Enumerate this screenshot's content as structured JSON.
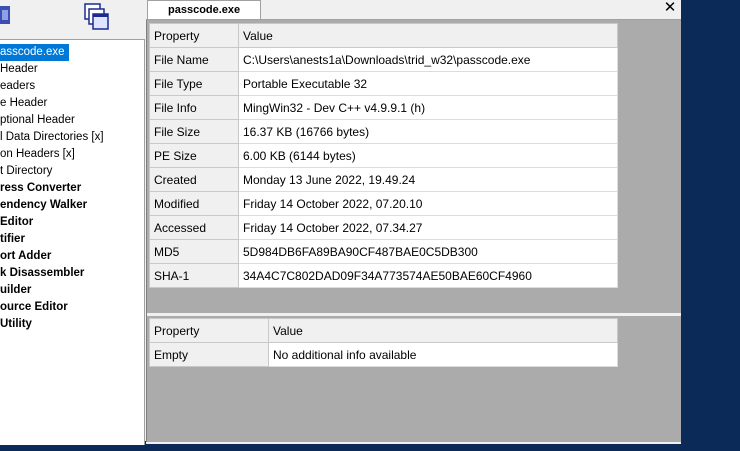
{
  "tree": {
    "items": [
      {
        "label": "asscode.exe",
        "selected": true
      },
      {
        "label": "Header"
      },
      {
        "label": "eaders"
      },
      {
        "label": "e Header"
      },
      {
        "label": "ptional Header"
      },
      {
        "label": "l Data Directories [x]"
      },
      {
        "label": "on Headers [x]"
      },
      {
        "label": "t Directory"
      },
      {
        "label": "ress Converter",
        "bold": true
      },
      {
        "label": "endency Walker",
        "bold": true
      },
      {
        "label": "Editor",
        "bold": true
      },
      {
        "label": "tifier",
        "bold": true
      },
      {
        "label": "ort Adder",
        "bold": true
      },
      {
        "label": "k Disassembler",
        "bold": true
      },
      {
        "label": "uilder",
        "bold": true
      },
      {
        "label": "ource Editor",
        "bold": true
      },
      {
        "label": " Utility",
        "bold": true
      }
    ]
  },
  "tabs": {
    "active_label": "passcode.exe",
    "close_glyph": "✕"
  },
  "info_table": {
    "headers": [
      "Property",
      "Value"
    ],
    "rows": [
      [
        "File Name",
        "C:\\Users\\anests1a\\Downloads\\trid_w32\\passcode.exe"
      ],
      [
        "File Type",
        "Portable Executable 32"
      ],
      [
        "File Info",
        "MingWin32 - Dev C++ v4.9.9.1 (h)"
      ],
      [
        "File Size",
        "16.37 KB (16766 bytes)"
      ],
      [
        "PE Size",
        "6.00 KB (6144 bytes)"
      ],
      [
        "Created",
        "Monday 13 June 2022, 19.49.24"
      ],
      [
        "Modified",
        "Friday 14 October 2022, 07.20.10"
      ],
      [
        "Accessed",
        "Friday 14 October 2022, 07.34.27"
      ],
      [
        "MD5",
        "5D984DB6FA89BA90CF487BAE0C5DB300"
      ],
      [
        "SHA-1",
        "34A4C7C802DAD09F34A773574AE50BAE60CF4960"
      ]
    ]
  },
  "extra_table": {
    "headers": [
      "Property",
      "Value"
    ],
    "rows": [
      [
        "Empty",
        "No additional info available"
      ]
    ]
  },
  "icons": [
    "program-icon",
    "windows-icon"
  ]
}
